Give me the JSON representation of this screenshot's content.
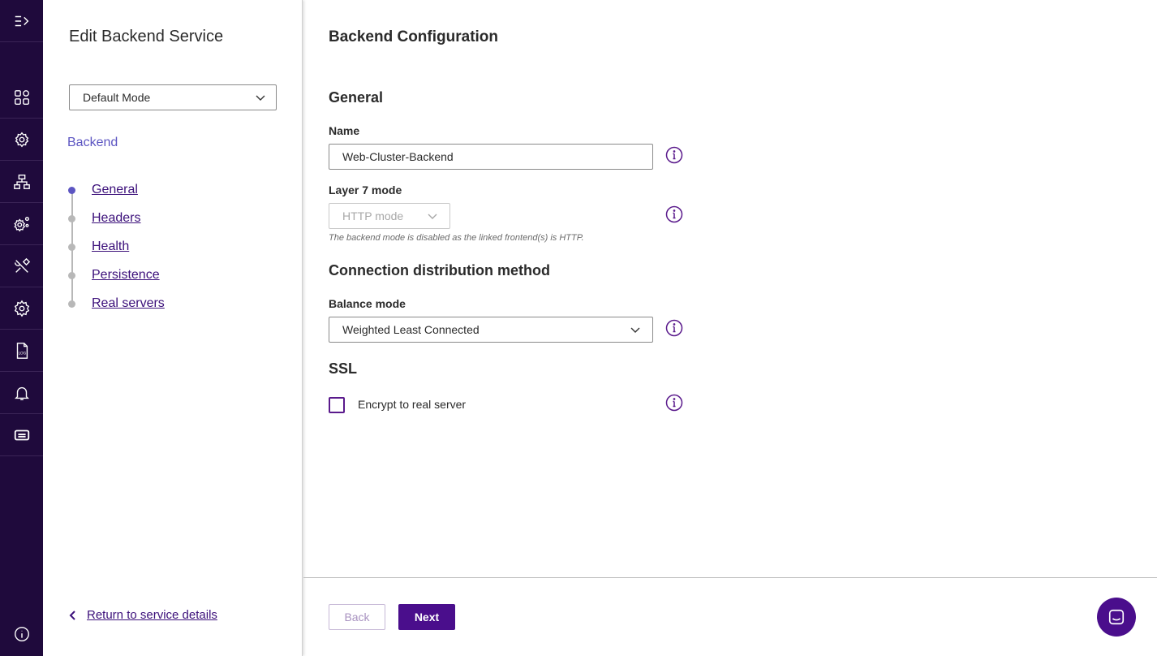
{
  "rail": {
    "icons": [
      "expand-menu-icon",
      "dashboard-icon",
      "services-config-icon",
      "network-icon",
      "system-config-icon",
      "tools-icon",
      "settings-icon",
      "logs-icon",
      "notifications-icon",
      "license-icon",
      "info-icon"
    ]
  },
  "sidebar": {
    "title": "Edit Backend Service",
    "mode_select": {
      "value": "Default Mode"
    },
    "section_label": "Backend",
    "steps": [
      {
        "label": "General",
        "active": true
      },
      {
        "label": "Headers",
        "active": false
      },
      {
        "label": "Health",
        "active": false
      },
      {
        "label": "Persistence",
        "active": false
      },
      {
        "label": "Real servers",
        "active": false
      }
    ],
    "return_link": "Return to service details"
  },
  "main": {
    "title": "Backend Configuration",
    "general": {
      "heading": "General",
      "name_label": "Name",
      "name_value": "Web-Cluster-Backend",
      "layer7_label": "Layer 7 mode",
      "layer7_value": "HTTP mode",
      "layer7_help": "The backend mode is disabled as the linked frontend(s) is HTTP."
    },
    "distribution": {
      "heading": "Connection distribution method",
      "balance_label": "Balance mode",
      "balance_value": "Weighted Least Connected"
    },
    "ssl": {
      "heading": "SSL",
      "encrypt_label": "Encrypt to real server",
      "encrypt_checked": false
    },
    "footer": {
      "back_label": "Back",
      "next_label": "Next"
    }
  },
  "colors": {
    "rail_bg": "#1f0a3c",
    "accent": "#4a0e8c",
    "active_step": "#5c55c2",
    "link": "#3b0f7a"
  }
}
